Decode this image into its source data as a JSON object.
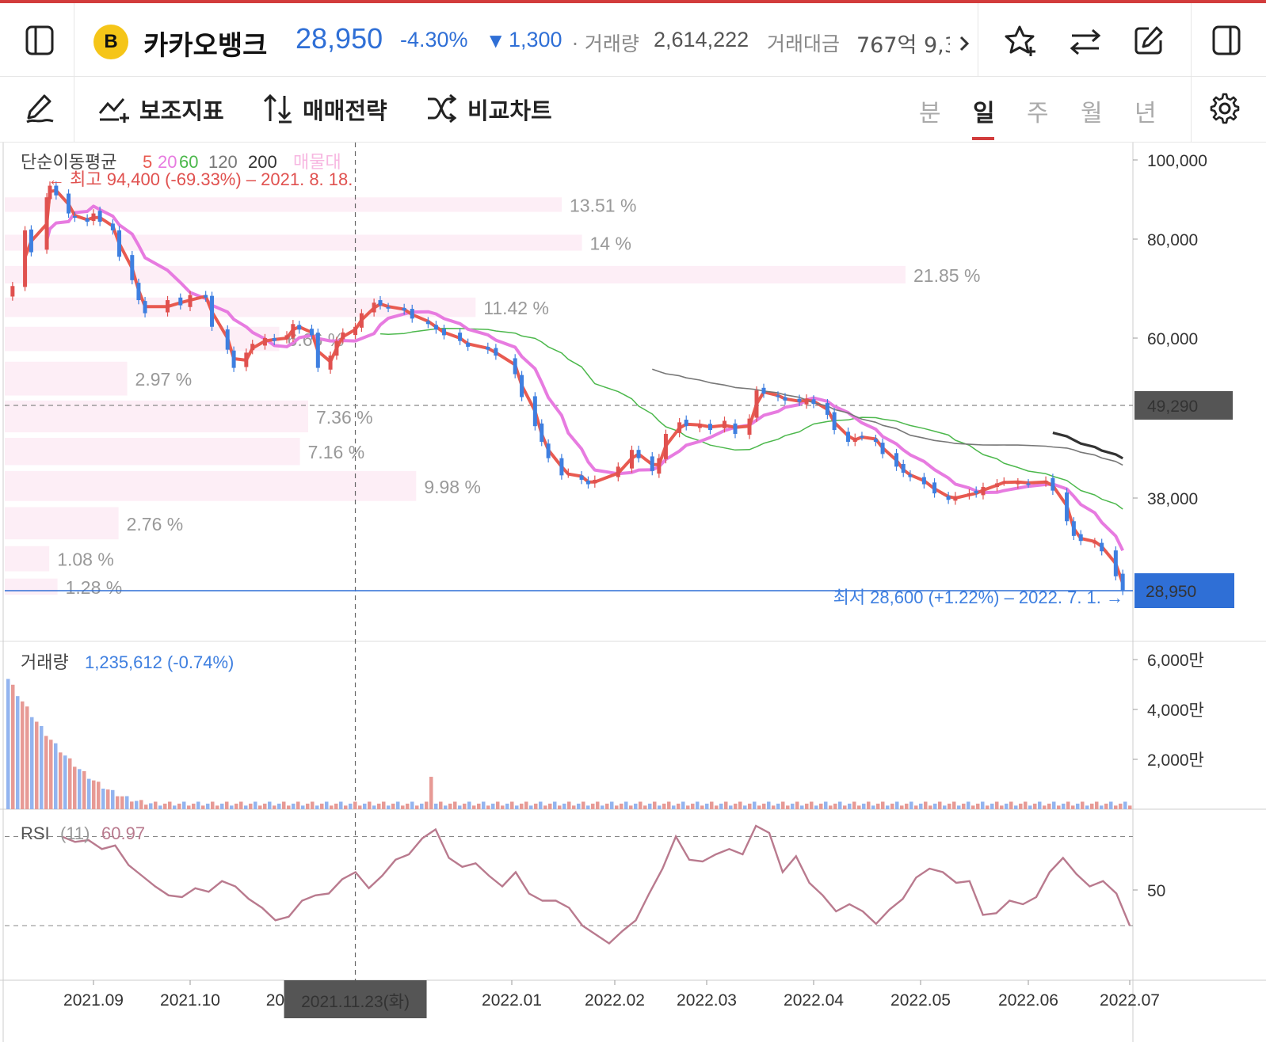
{
  "header": {
    "stock_icon_letter": "B",
    "stock_name": "카카오뱅크",
    "price": "28,950",
    "change_pct": "-4.30%",
    "change_arrow": "▼",
    "change_amt": "1,300",
    "volume_label": "· 거래량",
    "volume": "2,614,222",
    "amount_label": "거래대금",
    "amount": "767억 9,3",
    "more_icon": "chevron-right-icon",
    "icons": [
      "sidebar-left-icon",
      "star-add-icon",
      "swap-icon",
      "edit-icon",
      "sidebar-right-icon"
    ]
  },
  "toolbar": {
    "draw_icon": "pen-icon",
    "indicator_label": "보조지표",
    "strategy_label": "매매전략",
    "compare_label": "비교차트",
    "tabs": [
      "분",
      "일",
      "주",
      "월",
      "년"
    ],
    "active_tab": "일",
    "settings_icon": "gear-icon"
  },
  "colors": {
    "up": "#e0514f",
    "down": "#3e7fe0",
    "ma5": "#e85a50",
    "ma20": "#e77be0",
    "ma60": "#4cb84c",
    "ma120": "#777777",
    "ma200": "#333333",
    "volume_profile": "#fdeef6",
    "accent": "#2f6fd6",
    "rsi": "#b97a8e"
  },
  "chart_data": {
    "type": "candlestick",
    "title": "",
    "price_axis": {
      "ticks": [
        "100,000",
        "80,000",
        "60,000",
        "38,000"
      ],
      "current_price": "28,950",
      "crosshair_price": "49,290"
    },
    "x_axis": {
      "ticks": [
        "2021.09",
        "2021.10",
        "2021.",
        "2022.01",
        "2022.02",
        "2022.03",
        "2022.04",
        "2022.05",
        "2022.06",
        "2022.07"
      ],
      "crosshair_date": "2021.11.23(화)"
    },
    "legend": {
      "ma_label": "단순이동평균",
      "ma_periods": [
        "5",
        "20",
        "60",
        "120",
        "200"
      ],
      "ma_extra": "매물대"
    },
    "annotations": {
      "high": "← 최고 94,400 (-69.33%) – 2021. 8. 18.",
      "low": "최저 28,600 (+1.22%) – 2022. 7. 1. →"
    },
    "volume_profile": [
      {
        "price_top": 90000,
        "price_bottom": 86000,
        "pct": 13.51,
        "label": "13.51 %"
      },
      {
        "price_top": 81000,
        "price_bottom": 77000,
        "pct": 14,
        "label": "14 %"
      },
      {
        "price_top": 74000,
        "price_bottom": 70000,
        "pct": 21.85,
        "label": "21.85 %"
      },
      {
        "price_top": 67500,
        "price_bottom": 63500,
        "pct": 11.42,
        "label": "11.42 %"
      },
      {
        "price_top": 62000,
        "price_bottom": 57500,
        "pct": 6.66,
        "label": "6.66 %"
      },
      {
        "price_top": 56000,
        "price_bottom": 50500,
        "pct": 2.97,
        "label": "2.97 %"
      },
      {
        "price_top": 50000,
        "price_bottom": 45500,
        "pct": 7.36,
        "label": "7.36 %"
      },
      {
        "price_top": 45000,
        "price_bottom": 41500,
        "pct": 7.16,
        "label": "7.16 %"
      },
      {
        "price_top": 41000,
        "price_bottom": 37500,
        "pct": 9.98,
        "label": "9.98 %"
      },
      {
        "price_top": 37000,
        "price_bottom": 33500,
        "pct": 2.76,
        "label": "2.76 %"
      },
      {
        "price_top": 33000,
        "price_bottom": 30500,
        "pct": 1.08,
        "label": "1.08 %"
      },
      {
        "price_top": 30000,
        "price_bottom": 28500,
        "pct": 1.28,
        "label": "1.28 %"
      }
    ],
    "close_series": [
      [
        "2021-08-06",
        69800
      ],
      [
        "2021-08-10",
        82000
      ],
      [
        "2021-08-12",
        77000
      ],
      [
        "2021-08-17",
        90000
      ],
      [
        "2021-08-18",
        93000
      ],
      [
        "2021-08-20",
        90500
      ],
      [
        "2021-08-24",
        86000
      ],
      [
        "2021-08-26",
        85000
      ],
      [
        "2021-08-30",
        84000
      ],
      [
        "2021-09-01",
        86000
      ],
      [
        "2021-09-03",
        84000
      ],
      [
        "2021-09-07",
        82000
      ],
      [
        "2021-09-09",
        76000
      ],
      [
        "2021-09-13",
        71000
      ],
      [
        "2021-09-15",
        67000
      ],
      [
        "2021-09-17",
        64500
      ],
      [
        "2021-09-24",
        67000
      ],
      [
        "2021-09-28",
        66000
      ],
      [
        "2021-10-01",
        68000
      ],
      [
        "2021-10-06",
        67500
      ],
      [
        "2021-10-08",
        62000
      ],
      [
        "2021-10-13",
        58000
      ],
      [
        "2021-10-15",
        55000
      ],
      [
        "2021-10-19",
        57500
      ],
      [
        "2021-10-21",
        59000
      ],
      [
        "2021-10-25",
        60000
      ],
      [
        "2021-10-28",
        59500
      ],
      [
        "2021-11-01",
        60500
      ],
      [
        "2021-11-03",
        62500
      ],
      [
        "2021-11-05",
        61500
      ],
      [
        "2021-11-09",
        60500
      ],
      [
        "2021-11-11",
        55000
      ],
      [
        "2021-11-15",
        57000
      ],
      [
        "2021-11-17",
        59500
      ],
      [
        "2021-11-19",
        61000
      ],
      [
        "2021-11-23",
        62000
      ],
      [
        "2021-11-25",
        64500
      ],
      [
        "2021-11-29",
        66500
      ],
      [
        "2021-12-01",
        66000
      ],
      [
        "2021-12-03",
        65500
      ],
      [
        "2021-12-07",
        65000
      ],
      [
        "2021-12-09",
        63500
      ],
      [
        "2021-12-13",
        62500
      ],
      [
        "2021-12-15",
        61500
      ],
      [
        "2021-12-17",
        60500
      ],
      [
        "2021-12-21",
        59500
      ],
      [
        "2021-12-23",
        58500
      ],
      [
        "2021-12-28",
        58000
      ],
      [
        "2021-12-30",
        57000
      ],
      [
        "2022-01-04",
        54000
      ],
      [
        "2022-01-06",
        50500
      ],
      [
        "2022-01-10",
        46500
      ],
      [
        "2022-01-12",
        44500
      ],
      [
        "2022-01-14",
        42500
      ],
      [
        "2022-01-18",
        40500
      ],
      [
        "2022-01-20",
        40800
      ],
      [
        "2022-01-24",
        40000
      ],
      [
        "2022-01-26",
        39500
      ],
      [
        "2022-01-28",
        40000
      ],
      [
        "2022-02-04",
        41500
      ],
      [
        "2022-02-08",
        43500
      ],
      [
        "2022-02-10",
        42500
      ],
      [
        "2022-02-14",
        41000
      ],
      [
        "2022-02-16",
        42500
      ],
      [
        "2022-02-18",
        45500
      ],
      [
        "2022-02-22",
        47000
      ],
      [
        "2022-02-24",
        46500
      ],
      [
        "2022-02-28",
        46800
      ],
      [
        "2022-03-03",
        46000
      ],
      [
        "2022-03-07",
        47200
      ],
      [
        "2022-03-10",
        45500
      ],
      [
        "2022-03-14",
        47500
      ],
      [
        "2022-03-16",
        51500
      ],
      [
        "2022-03-18",
        51000
      ],
      [
        "2022-03-22",
        50500
      ],
      [
        "2022-03-24",
        50000
      ],
      [
        "2022-03-28",
        49800
      ],
      [
        "2022-03-30",
        50300
      ],
      [
        "2022-04-01",
        49500
      ],
      [
        "2022-04-05",
        48000
      ],
      [
        "2022-04-07",
        46000
      ],
      [
        "2022-04-11",
        44500
      ],
      [
        "2022-04-13",
        45000
      ],
      [
        "2022-04-15",
        45200
      ],
      [
        "2022-04-19",
        44500
      ],
      [
        "2022-04-21",
        43000
      ],
      [
        "2022-04-25",
        41500
      ],
      [
        "2022-04-27",
        40800
      ],
      [
        "2022-04-29",
        40300
      ],
      [
        "2022-05-03",
        39500
      ],
      [
        "2022-05-06",
        38500
      ],
      [
        "2022-05-10",
        37800
      ],
      [
        "2022-05-12",
        38200
      ],
      [
        "2022-05-16",
        38500
      ],
      [
        "2022-05-18",
        38500
      ],
      [
        "2022-05-20",
        39200
      ],
      [
        "2022-05-24",
        39600
      ],
      [
        "2022-05-26",
        39800
      ],
      [
        "2022-05-30",
        39700
      ],
      [
        "2022-06-02",
        39600
      ],
      [
        "2022-06-07",
        39900
      ],
      [
        "2022-06-09",
        38800
      ],
      [
        "2022-06-13",
        35500
      ],
      [
        "2022-06-15",
        34000
      ],
      [
        "2022-06-17",
        33500
      ],
      [
        "2022-06-21",
        33400
      ],
      [
        "2022-06-23",
        32500
      ],
      [
        "2022-06-27",
        30200
      ],
      [
        "2022-06-29",
        28950
      ]
    ],
    "volume": {
      "label": "거래량",
      "value": "1,235,612 (-0.74%)",
      "ticks": [
        "6,000만",
        "4,000만",
        "2,000만"
      ]
    },
    "rsi": {
      "label": "RSI",
      "period": "(11)",
      "value": "60.97",
      "tick": "50",
      "series": [
        80,
        77,
        78,
        73,
        75,
        64,
        58,
        52,
        47,
        46,
        51,
        49,
        55,
        52,
        45,
        40,
        33,
        35,
        44,
        47,
        48,
        56,
        60,
        51,
        58,
        67,
        70,
        79,
        84,
        68,
        63,
        65,
        58,
        52,
        60,
        48,
        44,
        44,
        40,
        30,
        25,
        20,
        27,
        33,
        48,
        62,
        80,
        67,
        66,
        70,
        73,
        70,
        86,
        82,
        60,
        69,
        54,
        47,
        38,
        42,
        38,
        31,
        39,
        45,
        57,
        62,
        60,
        54,
        55,
        36,
        37,
        44,
        42,
        46,
        60,
        68,
        59,
        52,
        55,
        48,
        30
      ]
    }
  }
}
